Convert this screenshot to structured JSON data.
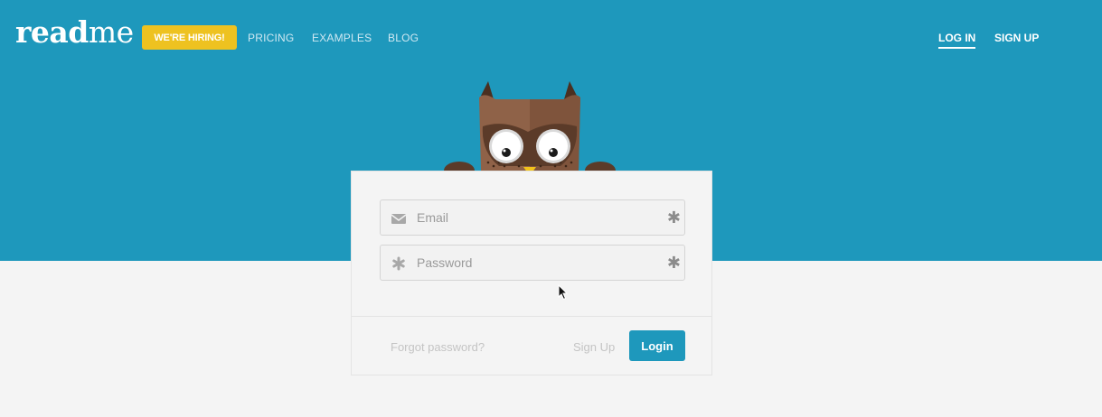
{
  "header": {
    "logo_bold": "read",
    "logo_light": "me",
    "hiring_label": "WE'RE HIRING!",
    "nav": [
      "PRICING",
      "EXAMPLES",
      "BLOG"
    ],
    "login_label": "LOG IN",
    "signup_label": "SIGN UP"
  },
  "login_form": {
    "email_placeholder": "Email",
    "email_value": "",
    "password_placeholder": "Password",
    "password_value": "",
    "required_mark": "✱",
    "forgot_label": "Forgot password?",
    "signup_label": "Sign Up",
    "submit_label": "Login"
  },
  "icons": {
    "email": "envelope-icon",
    "password": "asterisk-icon",
    "mascot": "owl-mascot"
  },
  "colors": {
    "brand_blue": "#1e98bc",
    "hiring_yellow": "#eec220",
    "background": "#f4f4f4"
  }
}
